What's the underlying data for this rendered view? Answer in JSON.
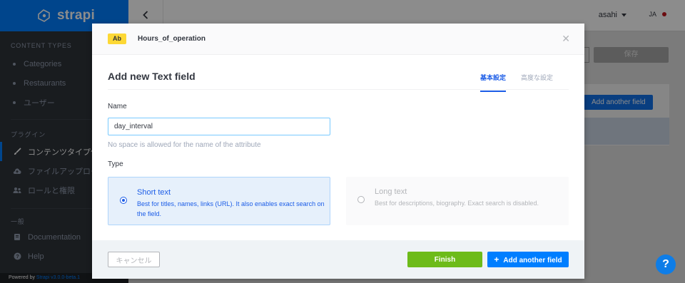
{
  "brand": {
    "name": "strapi"
  },
  "sidebar": {
    "content_types_title": "CONTENT TYPES",
    "content_types": [
      {
        "label": "Categories"
      },
      {
        "label": "Restaurants"
      },
      {
        "label": "ユーザー"
      }
    ],
    "plugins_title": "プラグイン",
    "plugins": [
      {
        "label": "コンテンツタイプ作成",
        "icon": "paint-brush-icon",
        "active": true
      },
      {
        "label": "ファイルアップロード",
        "icon": "cloud-upload-icon"
      },
      {
        "label": "ロールと権限",
        "icon": "users-icon"
      }
    ],
    "general_title": "一般",
    "general": [
      {
        "label": "Documentation",
        "icon": "book-icon"
      },
      {
        "label": "Help",
        "icon": "help-circle-icon"
      }
    ],
    "powered_prefix": "Powered by ",
    "powered_link": "Strapi v3.0.0-beta.1"
  },
  "header": {
    "username": "asahi",
    "lang": "JA"
  },
  "background": {
    "save_label": "保存",
    "add_another_field_label": "Add another field"
  },
  "modal": {
    "badge": "Ab",
    "content_type_name": "Hours_of_operation",
    "title": "Add new Text field",
    "tabs": [
      {
        "label": "基本設定",
        "active": true
      },
      {
        "label": "高度な設定",
        "active": false
      }
    ],
    "name_label": "Name",
    "name_value": "day_interval",
    "name_hint": "No space is allowed for the name of the attribute",
    "type_label": "Type",
    "types": [
      {
        "name": "Short text",
        "description": "Best for titles, names, links (URL). It also enables exact search on the field.",
        "selected": true
      },
      {
        "name": "Long text",
        "description": "Best for descriptions, biography. Exact search is disabled.",
        "selected": false
      }
    ],
    "cancel_label": "キャンセル",
    "finish_label": "Finish",
    "add_another_label": "Add another field"
  },
  "help": {
    "label": "?"
  },
  "colors": {
    "brand_blue": "#007eff",
    "finish_green": "#6dbb1a",
    "sidebar_bg": "#2e3339",
    "badge_yellow": "#fdd835"
  }
}
